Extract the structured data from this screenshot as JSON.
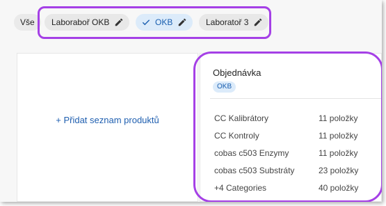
{
  "chips": {
    "all": "Vše",
    "items": [
      {
        "label": "Laboraboř OKB",
        "icon": "pencil-icon",
        "selected": false
      },
      {
        "label": "OKB",
        "icon": "pencil-icon",
        "selected": true
      },
      {
        "label": "Laboratoř 3",
        "icon": "pencil-icon",
        "selected": false
      }
    ]
  },
  "left_panel": {
    "add_products": "+ Přidat seznam produktů"
  },
  "order": {
    "title": "Objednávka",
    "badge": "OKB",
    "rows": [
      {
        "name": "CC Kalibrátory",
        "count": "11 položky"
      },
      {
        "name": "CC Kontroly",
        "count": "11 položky"
      },
      {
        "name": "cobas c503 Enzymy",
        "count": "11 položky"
      },
      {
        "name": "cobas c503 Substráty",
        "count": "23 položky"
      },
      {
        "name": "+4 Categories",
        "count": "40 položky"
      }
    ]
  },
  "colors": {
    "highlight": "#a540e6",
    "selected_bg": "#dcebfa",
    "accent": "#1a5fb0"
  }
}
